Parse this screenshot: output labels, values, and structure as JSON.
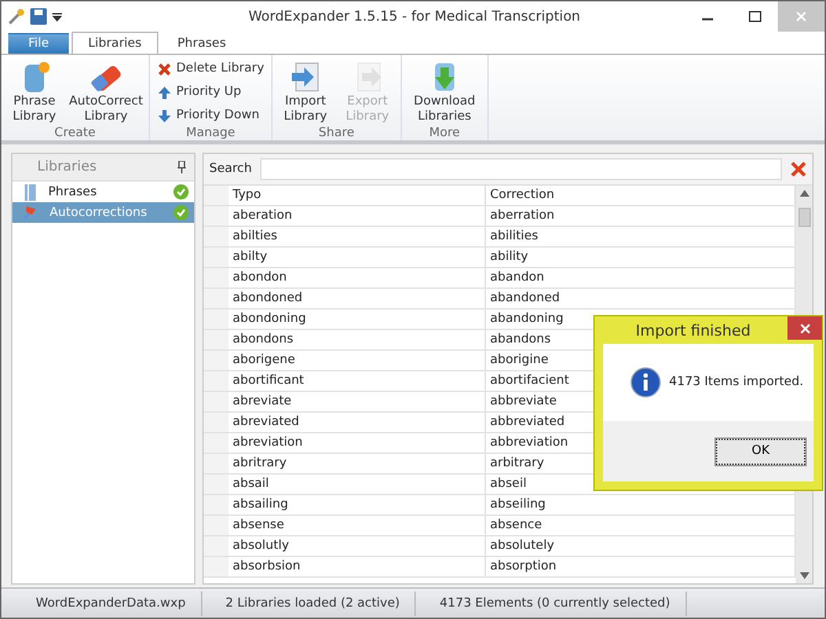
{
  "window": {
    "title": "WordExpander 1.5.15 - for Medical Transcription"
  },
  "tabs": [
    {
      "label": "File",
      "kind": "file",
      "selected": false
    },
    {
      "label": "Libraries",
      "kind": "tab",
      "selected": true
    },
    {
      "label": "Phrases",
      "kind": "tab",
      "selected": false
    }
  ],
  "ribbon": {
    "groups": [
      {
        "label": "Create",
        "kind": "large",
        "items": [
          {
            "label": "Phrase Library",
            "disabled": false
          },
          {
            "label": "AutoCorrect Library",
            "disabled": false
          }
        ]
      },
      {
        "label": "Manage",
        "kind": "small",
        "items": [
          {
            "label": "Delete Library"
          },
          {
            "label": "Priority Up"
          },
          {
            "label": "Priority Down"
          }
        ]
      },
      {
        "label": "Share",
        "kind": "large",
        "items": [
          {
            "label": "Import Library",
            "disabled": false
          },
          {
            "label": "Export Library",
            "disabled": true
          }
        ]
      },
      {
        "label": "More",
        "kind": "large",
        "items": [
          {
            "label": "Download Libraries",
            "disabled": false
          }
        ]
      }
    ]
  },
  "sidebar": {
    "title": "Libraries",
    "items": [
      {
        "label": "Phrases",
        "active": true,
        "selected": false
      },
      {
        "label": "Autocorrections",
        "active": true,
        "selected": true
      }
    ]
  },
  "search": {
    "label": "Search"
  },
  "table": {
    "columns": [
      "Typo",
      "Correction"
    ],
    "rows": [
      [
        "aberation",
        "aberration"
      ],
      [
        "abilties",
        "abilities"
      ],
      [
        "abilty",
        "ability"
      ],
      [
        "abondon",
        "abandon"
      ],
      [
        "abondoned",
        "abandoned"
      ],
      [
        "abondoning",
        "abandoning"
      ],
      [
        "abondons",
        "abandons"
      ],
      [
        "aborigene",
        "aborigine"
      ],
      [
        "abortificant",
        "abortifacient"
      ],
      [
        "abreviate",
        "abbreviate"
      ],
      [
        "abreviated",
        "abbreviated"
      ],
      [
        "abreviation",
        "abbreviation"
      ],
      [
        "abritrary",
        "arbitrary"
      ],
      [
        "absail",
        "abseil"
      ],
      [
        "absailing",
        "abseiling"
      ],
      [
        "absense",
        "absence"
      ],
      [
        "absolutly",
        "absolutely"
      ],
      [
        "absorbsion",
        "absorption"
      ]
    ]
  },
  "dialog": {
    "title": "Import finished",
    "message": "4173 Items imported.",
    "button": "OK"
  },
  "status_bar": [
    "WordExpanderData.wxp",
    "2 Libraries loaded (2 active)",
    "4173 Elements (0 currently selected)"
  ]
}
